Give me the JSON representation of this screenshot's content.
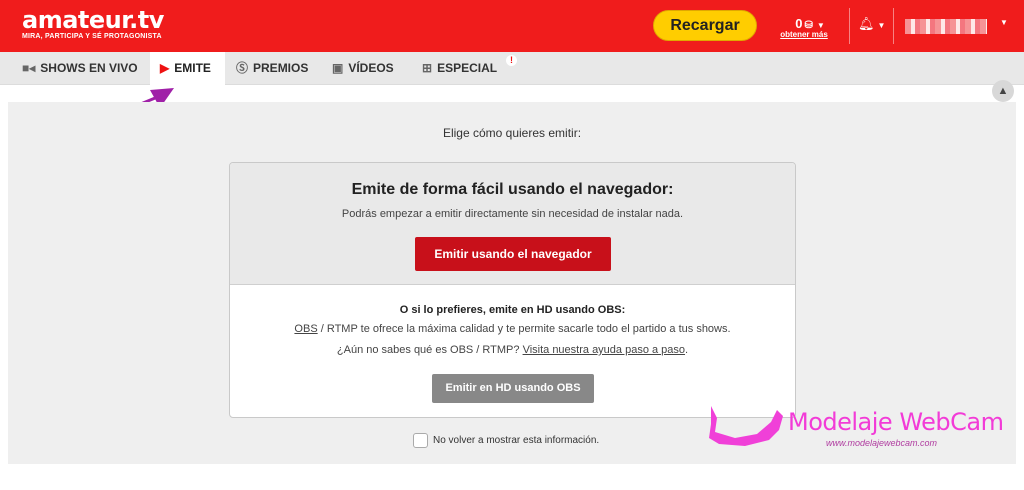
{
  "header": {
    "logo": "amateur.tv",
    "tagline": "MIRA, PARTICIPA Y SÉ PROTAGONISTA",
    "recharge_label": "Recargar",
    "credits_value": "0",
    "credits_link": "obtener más",
    "bell_icon": "bell-icon",
    "accent_color": "#f01c1c"
  },
  "tabs": [
    {
      "label": "SHOWS EN VIVO",
      "icon": "video-camera-icon"
    },
    {
      "label": "EMITE",
      "icon": "play-icon"
    },
    {
      "label": "PREMIOS",
      "icon": "coin-icon"
    },
    {
      "label": "VÍDEOS",
      "icon": "film-icon"
    },
    {
      "label": "ESPECIAL",
      "icon": "gift-icon",
      "badge": "!"
    }
  ],
  "main": {
    "prompt": "Elige cómo quieres emitir:",
    "browser": {
      "title": "Emite de forma fácil usando el navegador:",
      "subtitle": "Podrás empezar a emitir directamente sin necesidad de instalar nada.",
      "button": "Emitir usando el navegador"
    },
    "obs": {
      "title": "O si lo prefieres, emite en HD usando OBS:",
      "line1_link": "OBS",
      "line1_text": " / RTMP te ofrece la máxima calidad y te permite sacarle todo el partido a tus shows.",
      "line2_text": "¿Aún no sabes qué es OBS / RTMP? ",
      "line2_link": "Visita nuestra ayuda paso a paso",
      "line2_end": ".",
      "button": "Emitir en HD usando OBS"
    },
    "dont_show": "No volver a mostrar esta información."
  },
  "watermark": {
    "title": "Modelaje WebCam",
    "url": "www.modelajewebcam.com"
  }
}
